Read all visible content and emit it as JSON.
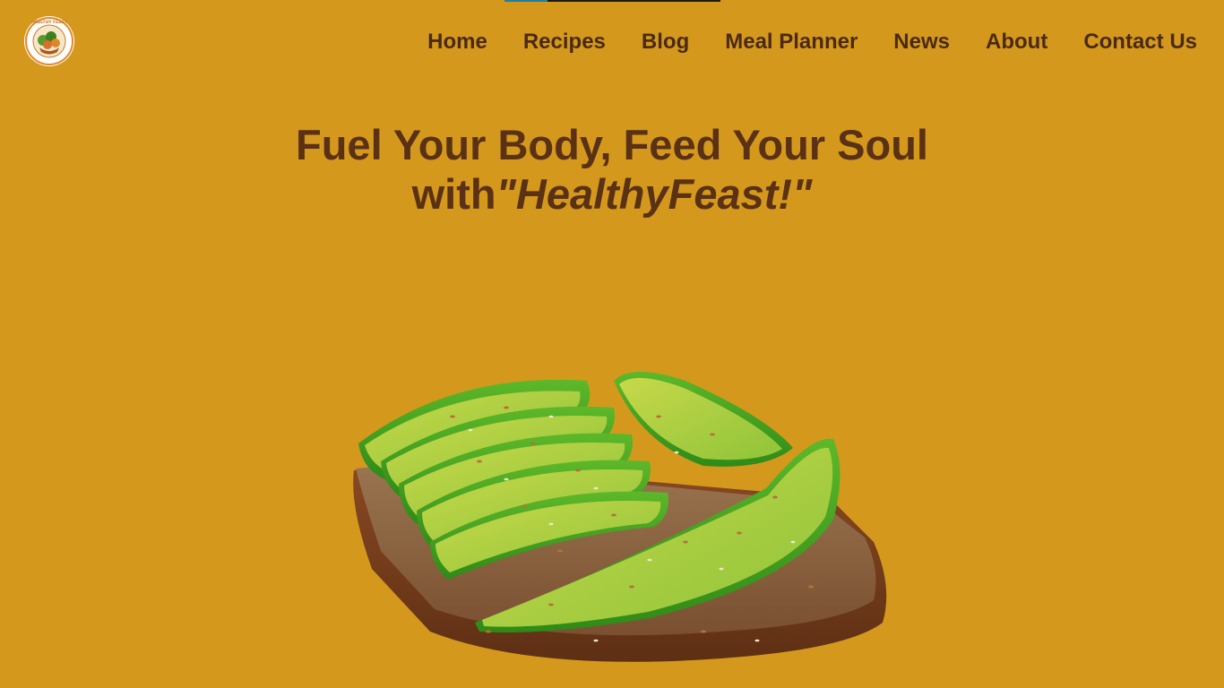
{
  "nav": {
    "items": [
      {
        "label": "Home"
      },
      {
        "label": "Recipes"
      },
      {
        "label": "Blog"
      },
      {
        "label": "Meal Planner"
      },
      {
        "label": "News"
      },
      {
        "label": "About"
      },
      {
        "label": "Contact Us"
      }
    ]
  },
  "logo": {
    "ring_text": "HEALTHY FEAST",
    "icon": "vegetable-basket-logo-icon"
  },
  "hero": {
    "title_line1": "Fuel Your Body, Feed Your Soul",
    "title_with": "with",
    "title_brand": "\"HealthyFeast!\""
  },
  "image": {
    "subject": "avocado-toast-image"
  },
  "colors": {
    "background": "#D4991C",
    "nav_text": "#4A2A14",
    "title_text": "#5A3114",
    "accent": "#1E7FA8"
  }
}
